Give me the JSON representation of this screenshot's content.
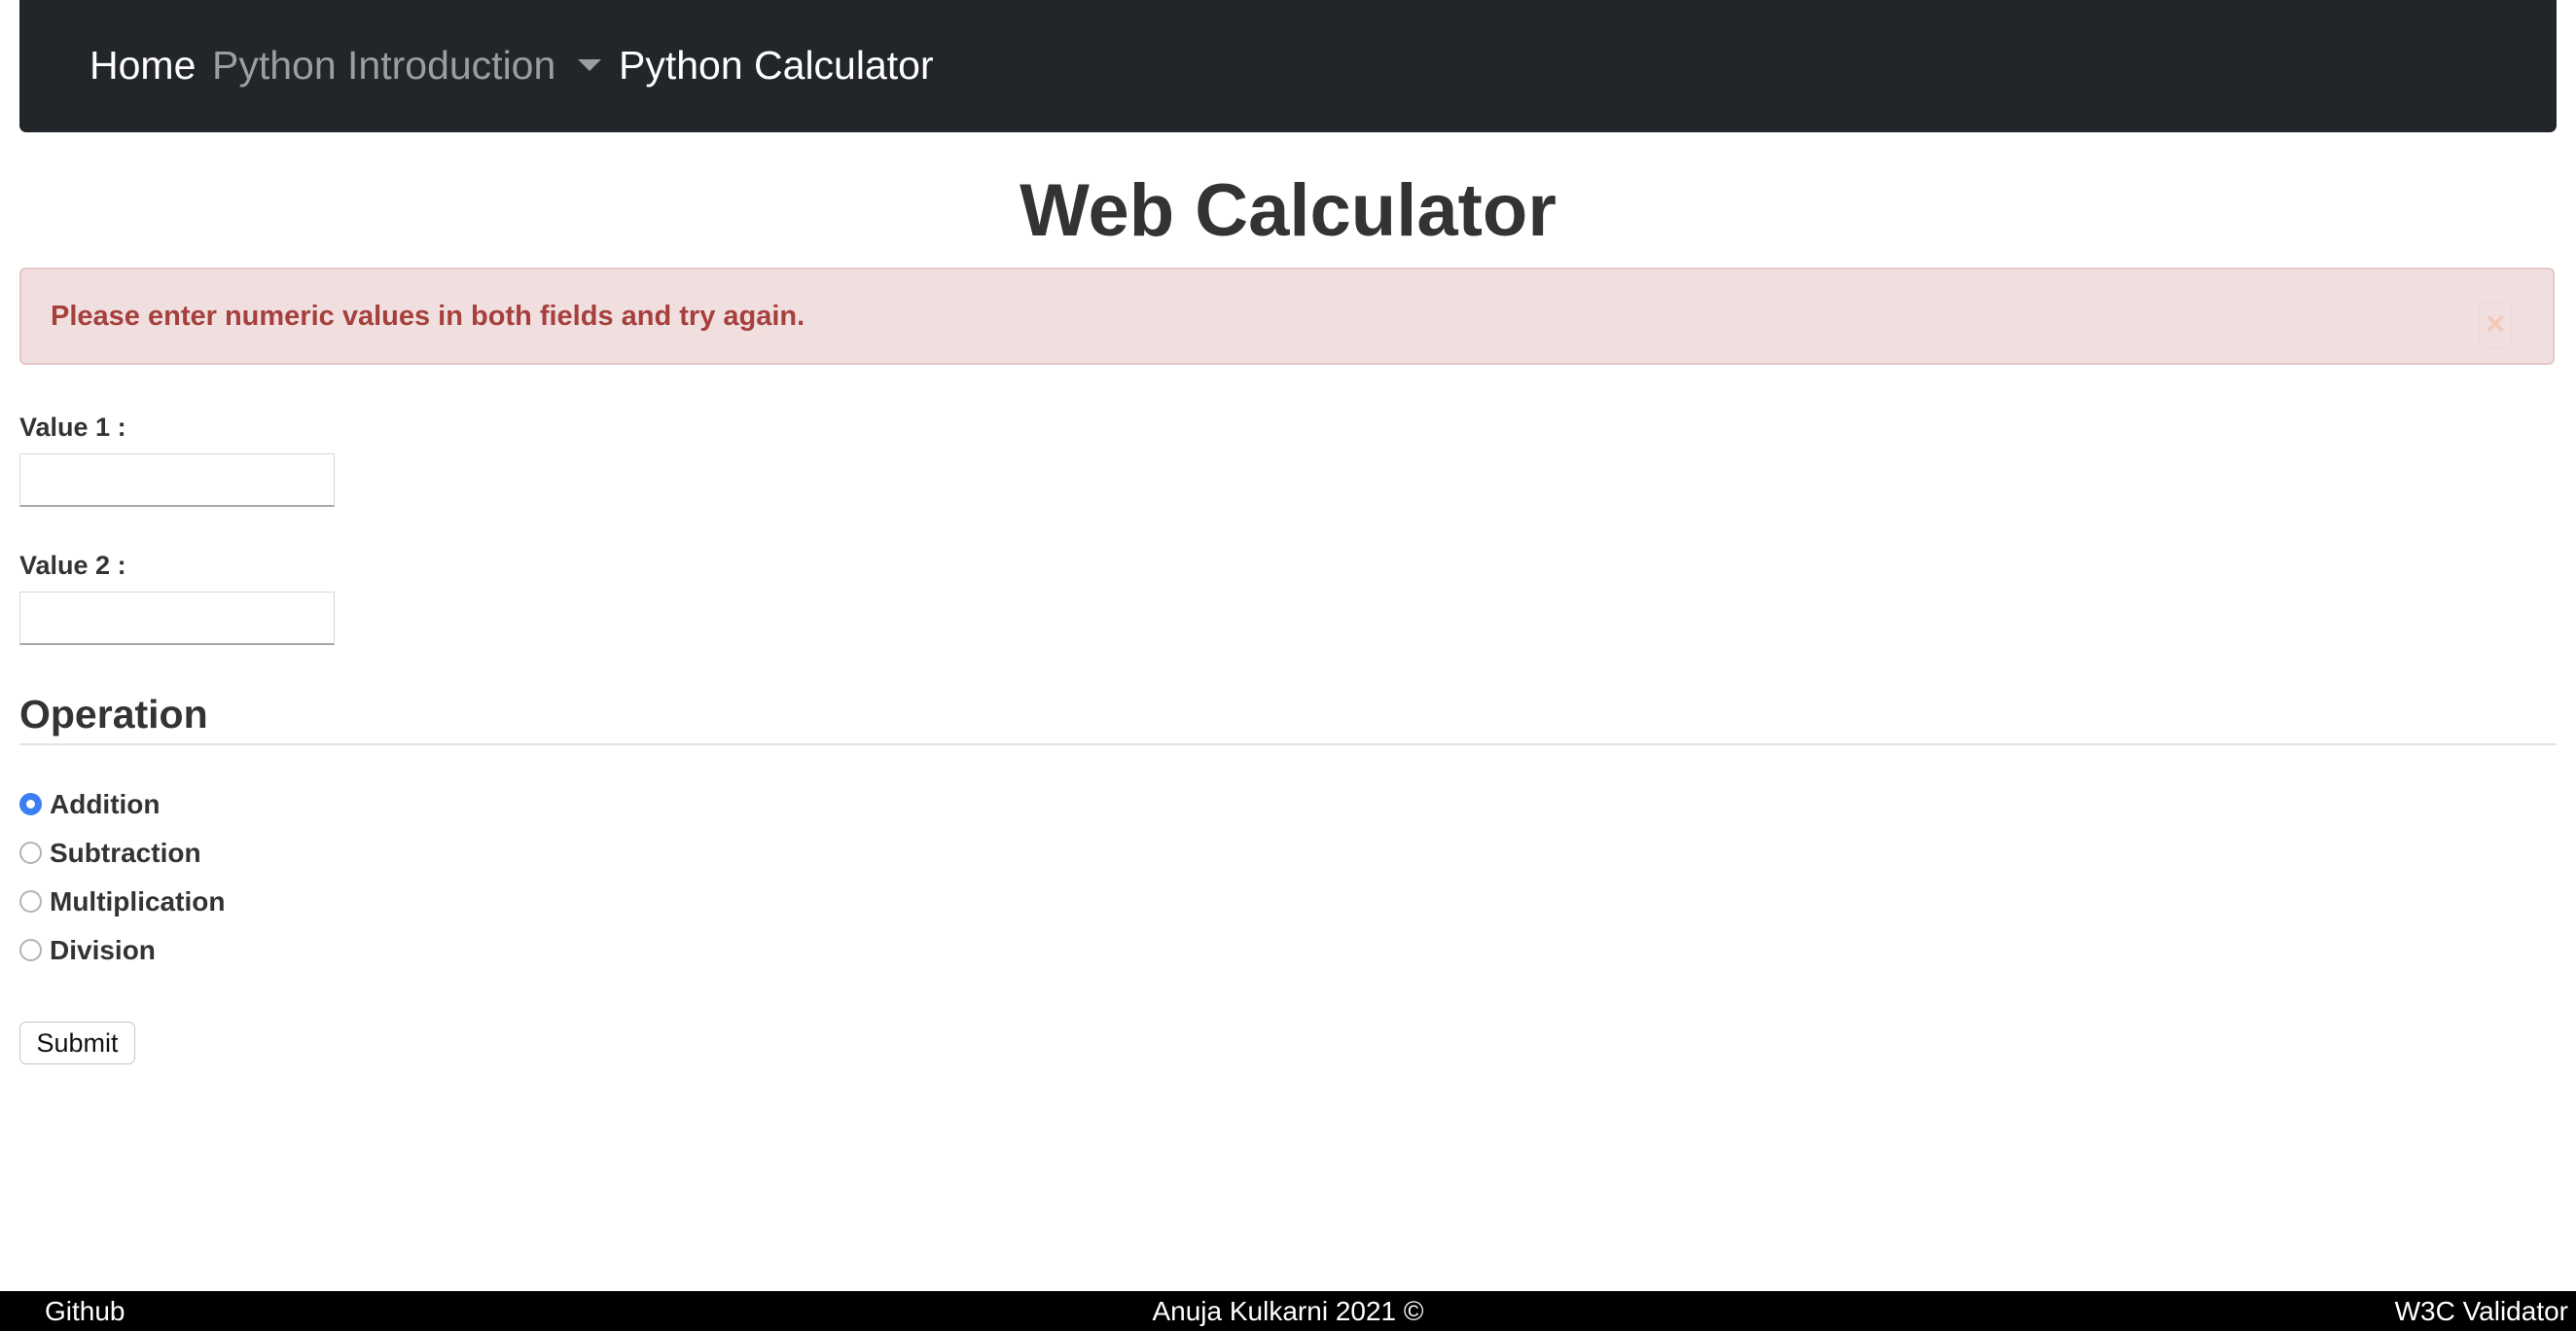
{
  "navbar": {
    "home": "Home",
    "intro": "Python Introduction",
    "calculator": "Python Calculator"
  },
  "page": {
    "title": "Web Calculator"
  },
  "alert": {
    "message": "Please enter numeric values in both fields and try again.",
    "close": "×"
  },
  "form": {
    "value1_label": "Value 1 :",
    "value1_value": "",
    "value2_label": "Value 2 :",
    "value2_value": "",
    "operation_heading": "Operation",
    "operations": [
      {
        "label": "Addition",
        "checked": true
      },
      {
        "label": "Subtraction",
        "checked": false
      },
      {
        "label": "Multiplication",
        "checked": false
      },
      {
        "label": "Division",
        "checked": false
      }
    ],
    "submit": "Submit"
  },
  "footer": {
    "github": "Github",
    "copyright": "Anuja Kulkarni 2021 ©",
    "validator": "W3C Validator"
  },
  "colors": {
    "navbar_bg": "#222529",
    "alert_bg": "#f1dfdf",
    "alert_text": "#a5403d",
    "radio_accent": "#3b7ff2",
    "footer_bg": "#000000"
  },
  "icons": {
    "nav_dropdown": "caret-down-icon",
    "alert_close": "close-icon"
  }
}
